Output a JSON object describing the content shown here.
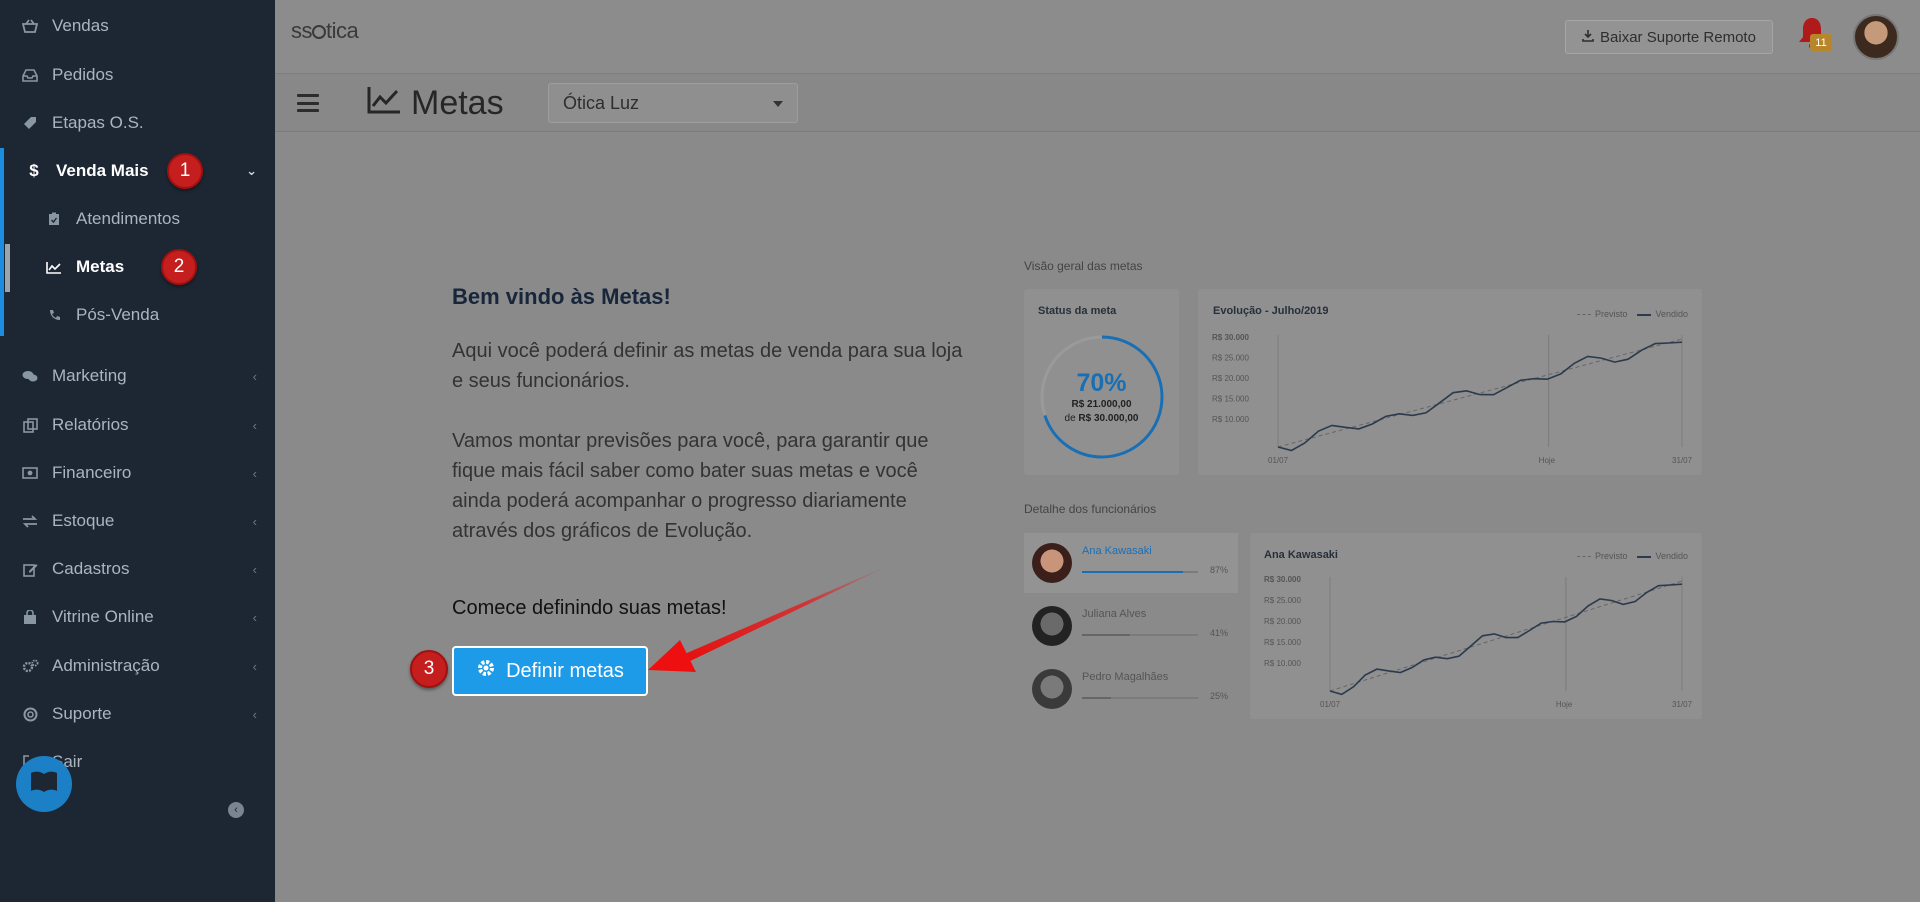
{
  "sidebar": {
    "items": [
      {
        "label": "Vendas",
        "icon": "basket-icon",
        "caret": false
      },
      {
        "label": "Pedidos",
        "icon": "inbox-icon",
        "caret": false
      },
      {
        "label": "Etapas O.S.",
        "icon": "tag-icon",
        "caret": false
      },
      {
        "label": "Venda Mais",
        "icon": "dollar-icon",
        "caret": true,
        "active": true
      },
      {
        "label": "Atendimentos",
        "icon": "clipboard-icon",
        "sub": true
      },
      {
        "label": "Metas",
        "icon": "chart-line-icon",
        "sub": true,
        "active": true
      },
      {
        "label": "Pós-Venda",
        "icon": "phone-icon",
        "sub": true
      },
      {
        "label": "Marketing",
        "icon": "comments-icon",
        "caret": true
      },
      {
        "label": "Relatórios",
        "icon": "copy-icon",
        "caret": true
      },
      {
        "label": "Financeiro",
        "icon": "money-icon",
        "caret": true
      },
      {
        "label": "Estoque",
        "icon": "exchange-icon",
        "caret": true
      },
      {
        "label": "Cadastros",
        "icon": "edit-icon",
        "caret": true
      },
      {
        "label": "Vitrine Online",
        "icon": "shopping-bag-icon",
        "caret": true
      },
      {
        "label": "Administração",
        "icon": "cogs-icon",
        "caret": true
      },
      {
        "label": "Suporte",
        "icon": "life-ring-icon",
        "caret": true
      },
      {
        "label": "Sair",
        "icon": "sign-out-icon",
        "caret": false
      }
    ],
    "step_badges": {
      "one": "1",
      "two": "2",
      "three": "3"
    }
  },
  "header": {
    "logo_text_pre": "ss",
    "logo_text_post": "tica",
    "remote_button": "Baixar Suporte Remoto",
    "notification_count": "11"
  },
  "subheader": {
    "title": "Metas",
    "store_selected": "Ótica Luz"
  },
  "content": {
    "welcome_title": "Bem vindo às Metas!",
    "para1": "Aqui você poderá definir as metas de venda para sua loja e seus funcionários.",
    "para2": "Vamos montar previsões para você, para garantir que fique mais fácil saber como bater suas metas e você ainda poderá acompanhar o progresso diariamente através dos gráficos de Evolução.",
    "start_text": "Comece definindo suas metas!",
    "define_button": "Definir metas"
  },
  "preview": {
    "overview_label": "Visão geral das metas",
    "status_title": "Status da meta",
    "status_percent": "70%",
    "status_value": "R$ 21.000,00",
    "status_of": "de",
    "status_goal": "R$ 30.000,00",
    "evolution_title": "Evolução - Julho/2019",
    "legend_forecast": "Previsto",
    "legend_sold": "Vendido",
    "y_ticks": [
      "R$ 30.000",
      "R$ 25.000",
      "R$ 20.000",
      "R$ 15.000",
      "R$ 10.000"
    ],
    "x_ticks": [
      "01/07",
      "Hoje",
      "31/07"
    ],
    "employees_label": "Detalhe dos funcionários",
    "employees": [
      {
        "name": "Ana Kawasaki",
        "pct": "87%",
        "value": 0.87
      },
      {
        "name": "Juliana Alves",
        "pct": "41%",
        "value": 0.41
      },
      {
        "name": "Pedro Magalhães",
        "pct": "25%",
        "value": 0.25
      }
    ],
    "employee_chart_title": "Ana Kawasaki",
    "colors": {
      "accent": "#1e9be8",
      "line": "#2b3a4c",
      "progress": "#1a6fb4"
    }
  }
}
